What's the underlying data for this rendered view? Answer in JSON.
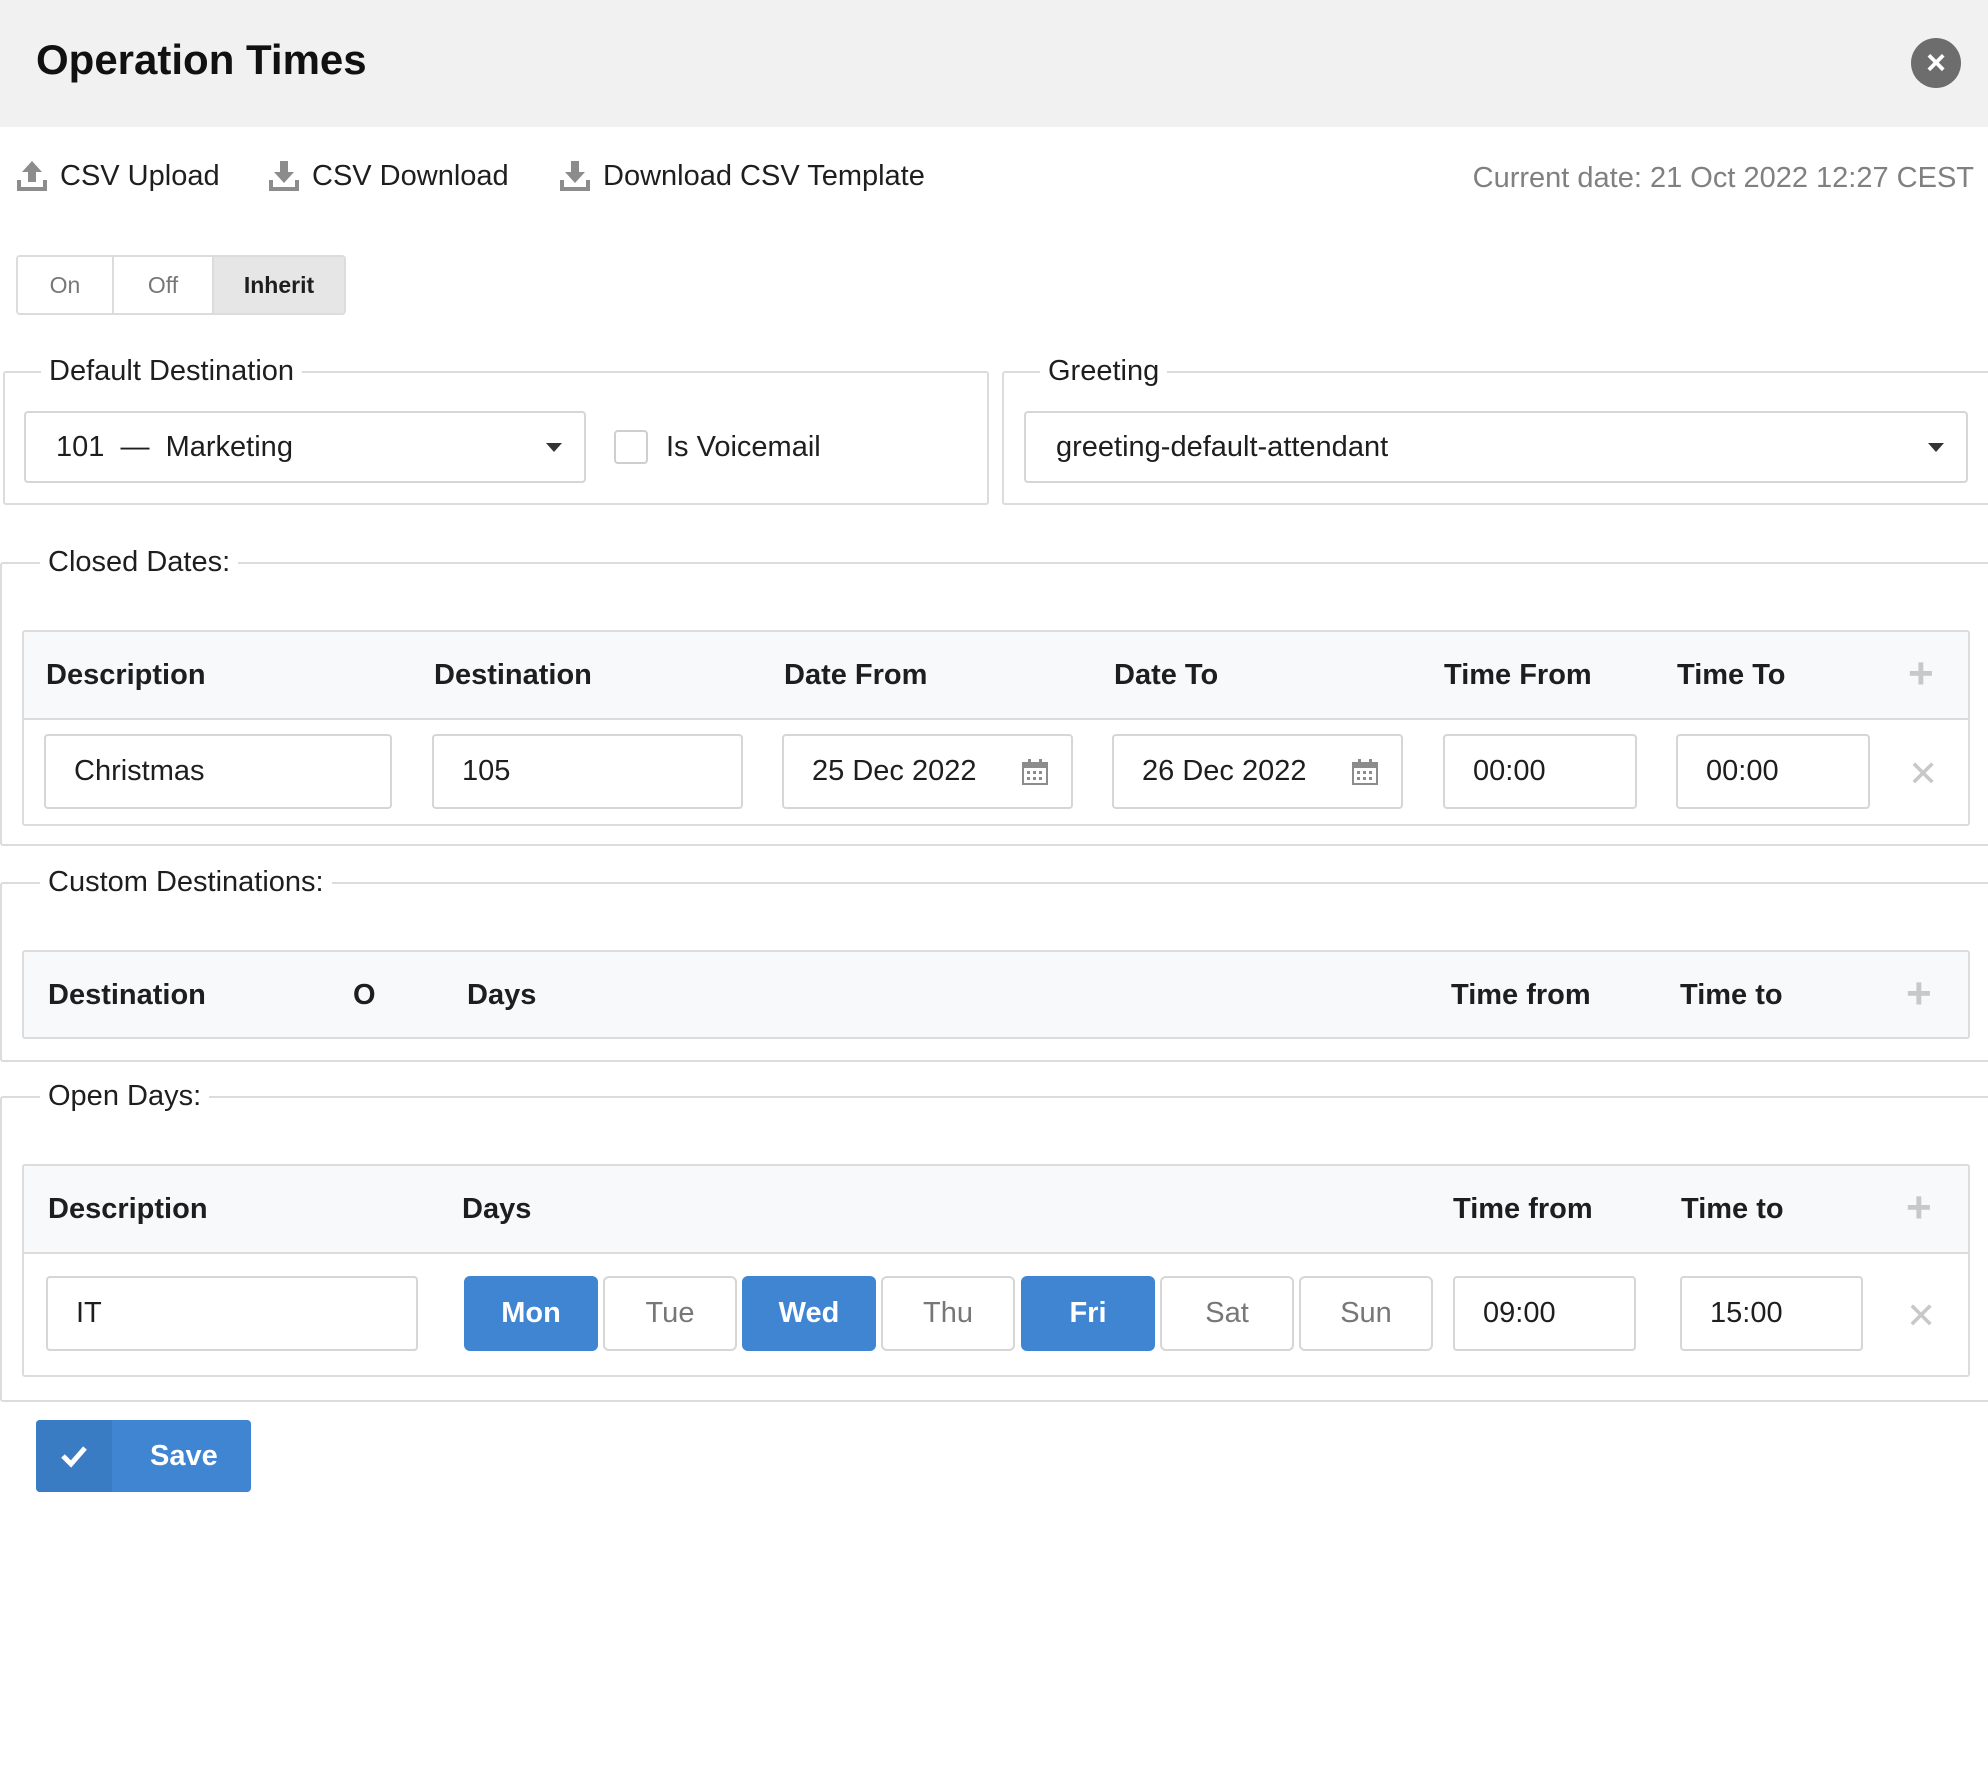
{
  "header": {
    "title": "Operation Times"
  },
  "toolbar": {
    "csv_upload": "CSV Upload",
    "csv_download": "CSV Download",
    "download_template": "Download CSV Template",
    "current_date": "Current date: 21 Oct 2022 12:27 CEST"
  },
  "mode": {
    "on": "On",
    "off": "Off",
    "inherit": "Inherit",
    "selected": "Inherit"
  },
  "default_destination": {
    "legend": "Default Destination",
    "value": "101  —  Marketing",
    "is_voicemail_label": "Is Voicemail",
    "is_voicemail": false
  },
  "greeting": {
    "legend": "Greeting",
    "value": "greeting-default-attendant"
  },
  "closed_dates": {
    "legend": "Closed Dates:",
    "headers": [
      "Description",
      "Destination",
      "Date From",
      "Date To",
      "Time From",
      "Time To"
    ],
    "rows": [
      {
        "description": "Christmas",
        "destination": "105",
        "date_from": "25 Dec 2022",
        "date_to": "26 Dec 2022",
        "time_from": "00:00",
        "time_to": "00:00"
      }
    ]
  },
  "custom_destinations": {
    "legend": "Custom Destinations:",
    "headers": [
      "Destination",
      "O",
      "Days",
      "Time from",
      "Time to"
    ]
  },
  "open_days": {
    "legend": "Open Days:",
    "headers": [
      "Description",
      "Days",
      "Time from",
      "Time to"
    ],
    "rows": [
      {
        "description": "IT",
        "days": [
          "Mon",
          "Tue",
          "Wed",
          "Thu",
          "Fri",
          "Sat",
          "Sun"
        ],
        "active_days": [
          "Mon",
          "Wed",
          "Fri"
        ],
        "time_from": "09:00",
        "time_to": "15:00"
      }
    ]
  },
  "save": {
    "label": "Save"
  },
  "colors": {
    "accent": "#3f85d2",
    "muted": "#808080"
  }
}
